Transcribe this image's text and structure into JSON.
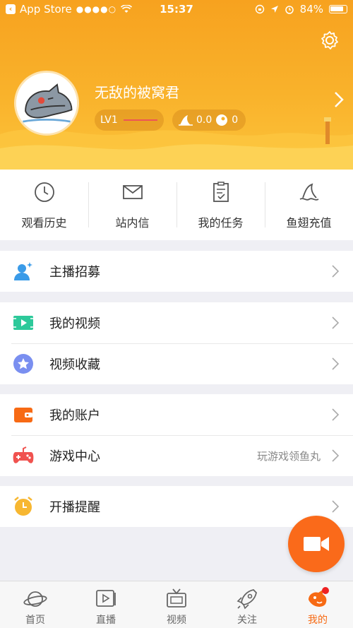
{
  "status_bar": {
    "back_app": "App Store",
    "signal": "●●●●○",
    "time": "15:37",
    "battery": "84%"
  },
  "profile": {
    "username": "无敌的被窝君",
    "level": "LV1",
    "fins": "0.0",
    "fish_balls": "0"
  },
  "quick_actions": [
    {
      "label": "观看历史",
      "icon": "clock-icon"
    },
    {
      "label": "站内信",
      "icon": "mail-icon"
    },
    {
      "label": "我的任务",
      "icon": "task-list-icon"
    },
    {
      "label": "鱼翅充值",
      "icon": "shark-fin-icon"
    }
  ],
  "menu": {
    "recruit": {
      "label": "主播招募",
      "icon": "person-add-icon",
      "color": "#3a9be8"
    },
    "my_videos": {
      "label": "我的视频",
      "icon": "video-play-icon",
      "color": "#2dc99a"
    },
    "favorites": {
      "label": "视频收藏",
      "icon": "star-icon",
      "color": "#7a8ff0"
    },
    "account": {
      "label": "我的账户",
      "icon": "wallet-icon",
      "color": "#f76a14"
    },
    "games": {
      "label": "游戏中心",
      "sub": "玩游戏领鱼丸",
      "icon": "gamepad-icon",
      "color": "#f0524f"
    },
    "reminder": {
      "label": "开播提醒",
      "icon": "alarm-clock-icon",
      "color": "#f7b731"
    }
  },
  "tabs": [
    {
      "label": "首页",
      "icon": "planet-icon"
    },
    {
      "label": "直播",
      "icon": "live-play-icon"
    },
    {
      "label": "视频",
      "icon": "tv-icon"
    },
    {
      "label": "关注",
      "icon": "rocket-icon"
    },
    {
      "label": "我的",
      "icon": "fish-icon",
      "active": true
    }
  ],
  "colors": {
    "accent": "#f76a14",
    "header": "#f9b22b"
  }
}
